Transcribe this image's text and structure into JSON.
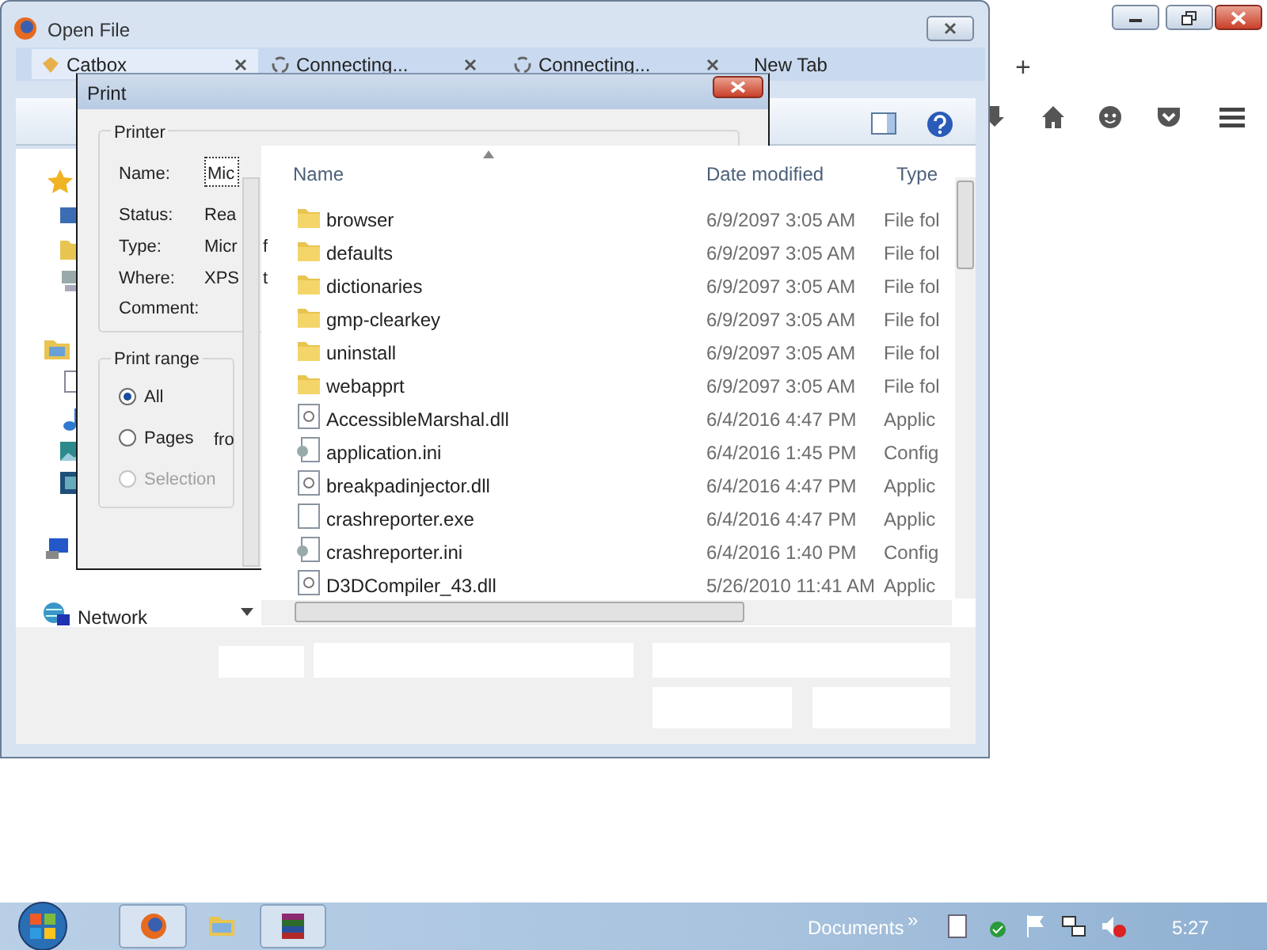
{
  "firefox": {
    "tabs": [
      {
        "label": "Catbox",
        "selected": true
      },
      {
        "label": "Connecting...",
        "selected": false
      },
      {
        "label": "Connecting...",
        "selected": false
      },
      {
        "label": "New Tab",
        "selected": false
      }
    ],
    "new_tab_button": "+"
  },
  "open_file": {
    "title": "Open File",
    "columns": [
      "Name",
      "Date modified",
      "Type"
    ],
    "rows": [
      {
        "name": "browser",
        "date": "6/9/2097 3:05 AM",
        "type": "File fol",
        "kind": "folder"
      },
      {
        "name": "defaults",
        "date": "6/9/2097 3:05 AM",
        "type": "File fol",
        "kind": "folder"
      },
      {
        "name": "dictionaries",
        "date": "6/9/2097 3:05 AM",
        "type": "File fol",
        "kind": "folder"
      },
      {
        "name": "gmp-clearkey",
        "date": "6/9/2097 3:05 AM",
        "type": "File fol",
        "kind": "folder"
      },
      {
        "name": "uninstall",
        "date": "6/9/2097 3:05 AM",
        "type": "File fol",
        "kind": "folder"
      },
      {
        "name": "webapprt",
        "date": "6/9/2097 3:05 AM",
        "type": "File fol",
        "kind": "folder"
      },
      {
        "name": "AccessibleMarshal.dll",
        "date": "6/4/2016 4:47 PM",
        "type": "Applic",
        "kind": "dll"
      },
      {
        "name": "application.ini",
        "date": "6/4/2016 1:45 PM",
        "type": "Config",
        "kind": "ini"
      },
      {
        "name": "breakpadinjector.dll",
        "date": "6/4/2016 4:47 PM",
        "type": "Applic",
        "kind": "dll"
      },
      {
        "name": "crashreporter.exe",
        "date": "6/4/2016 4:47 PM",
        "type": "Applic",
        "kind": "exe"
      },
      {
        "name": "crashreporter.ini",
        "date": "6/4/2016 1:40 PM",
        "type": "Config",
        "kind": "ini"
      },
      {
        "name": "D3DCompiler_43.dll",
        "date": "5/26/2010 11:41 AM",
        "type": "Applic",
        "kind": "dll"
      }
    ],
    "nav_network": "Network"
  },
  "print": {
    "title": "Print",
    "printer_group": "Printer",
    "fields": [
      {
        "label": "Name:",
        "value": "Mic"
      },
      {
        "label": "Status:",
        "value": "Rea"
      },
      {
        "label": "Type:",
        "value": "Micr",
        "extra": "f"
      },
      {
        "label": "Where:",
        "value": "XPS",
        "extra": "t"
      },
      {
        "label": "Comment:"
      }
    ],
    "range_group": "Print range",
    "range_options": [
      {
        "label": "All",
        "selected": true,
        "disabled": false
      },
      {
        "label": "Pages",
        "selected": false,
        "disabled": false,
        "extra": "fro"
      },
      {
        "label": "Selection",
        "selected": false,
        "disabled": true
      }
    ]
  },
  "taskbar": {
    "toolbar": "Documents",
    "chevron": "»",
    "clock": "5:27"
  }
}
